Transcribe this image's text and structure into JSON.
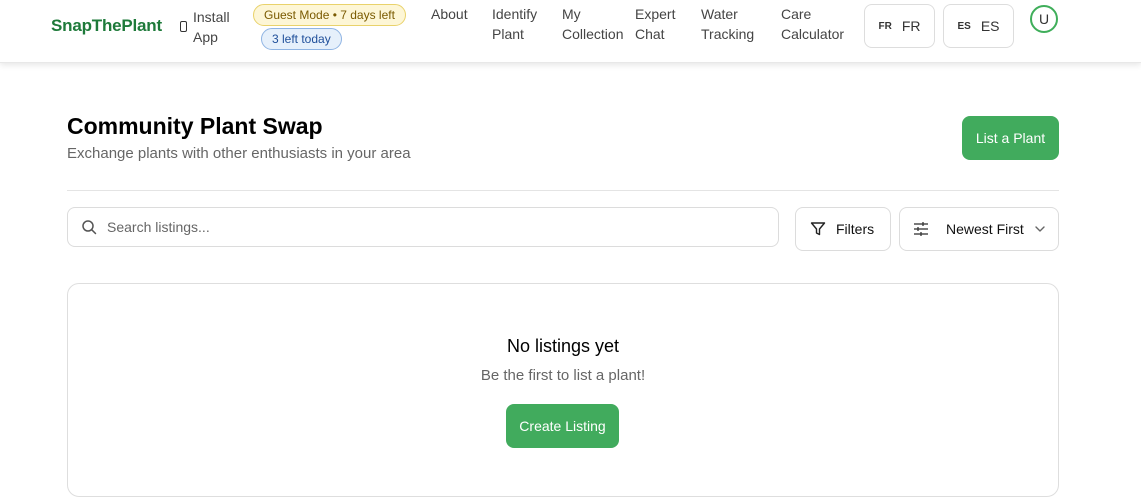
{
  "header": {
    "logo": "SnapThePlant",
    "install_label": "Install App",
    "guest_badge": "Guest Mode • 7 days left",
    "remaining_badge": "3 left today",
    "nav": [
      {
        "label": "About"
      },
      {
        "label": "Identify Plant"
      },
      {
        "label": "My Collection"
      },
      {
        "label": "Expert Chat"
      },
      {
        "label": "Water Tracking"
      },
      {
        "label": "Care Calculator"
      }
    ],
    "languages": [
      {
        "small": "FR",
        "label": "FR"
      },
      {
        "small": "ES",
        "label": "ES"
      }
    ],
    "avatar_initial": "U"
  },
  "page": {
    "title": "Community Plant Swap",
    "subtitle": "Exchange plants with other enthusiasts in your area",
    "list_button": "List a Plant"
  },
  "toolbar": {
    "search_placeholder": "Search listings...",
    "search_value": "",
    "filters_label": "Filters",
    "sort_selected": "Newest First"
  },
  "empty_state": {
    "title": "No listings yet",
    "subtitle": "Be the first to list a plant!",
    "button": "Create Listing"
  },
  "colors": {
    "brand_green": "#1e7a3a",
    "button_green": "#41ab5d",
    "guest_badge_bg": "#fdf6d6",
    "remaining_badge_bg": "#e6f0fb"
  },
  "icons": {
    "install": "phone-icon",
    "search": "search-icon",
    "filters": "filter-icon",
    "sort": "sliders-icon",
    "sort_dropdown": "chevron-down-icon"
  }
}
